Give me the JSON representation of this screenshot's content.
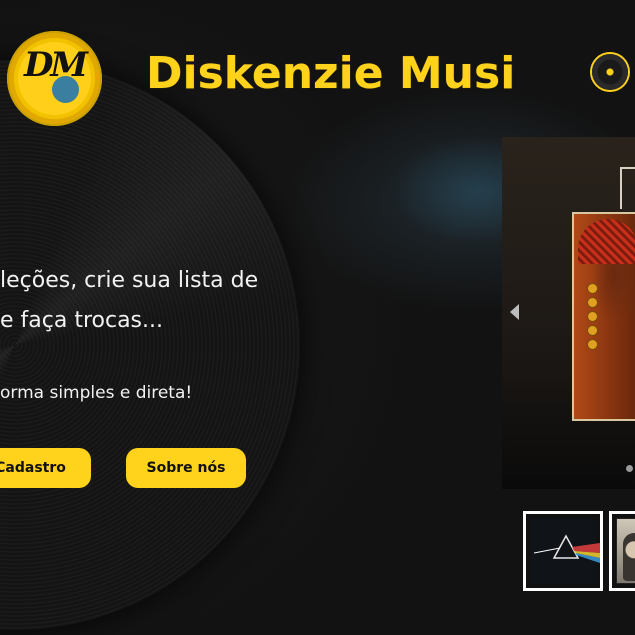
{
  "brand": {
    "title": "Diskenzie Musi",
    "logo_text": "DM",
    "logo_colors": {
      "outer": "#e0a800",
      "disc": "#ffcf1a",
      "center": "#3b7fa0"
    },
    "disc_icon": "vinyl-record-icon"
  },
  "hero": {
    "line1": "leções, crie sua lista de",
    "line2": "e faça trocas...",
    "line3": "orma simples e direta!"
  },
  "buttons": {
    "cadastro": "Cadastro",
    "sobre": "Sobre nós"
  },
  "carousel": {
    "prev_icon": "chevron-left-icon",
    "dots": 1
  },
  "thumbnails": [
    {
      "name": "prism-album-thumbnail"
    },
    {
      "name": "portrait-album-thumbnail"
    }
  ],
  "colors": {
    "accent": "#ffd21c",
    "background": "#161616",
    "text": "#f2f2f2"
  }
}
